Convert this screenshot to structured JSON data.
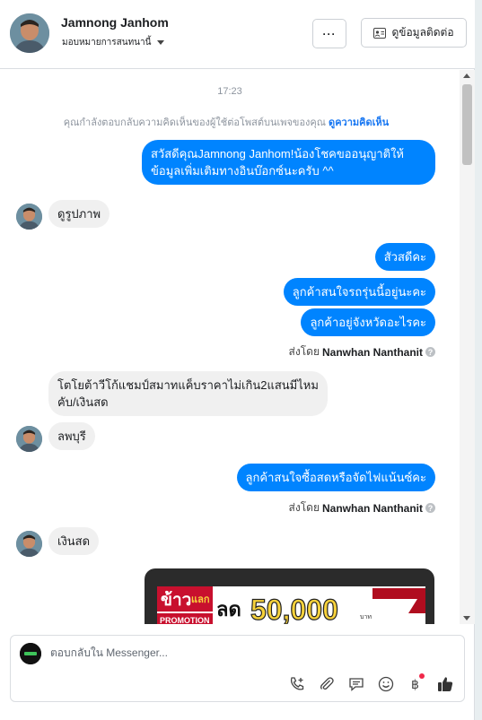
{
  "header": {
    "name": "Jamnong Janhom",
    "assign_label": "มอบหมายการสนทนานี้",
    "more_label": "···",
    "contact_label": "ดูข้อมูลติดต่อ"
  },
  "chat": {
    "time": "17:23",
    "notice_text": "คุณกำลังตอบกลับความคิดเห็นของผู้ใช้ต่อโพสต์บนเพจของคุณ",
    "notice_link": "ดูความคิดเห็น",
    "messages": [
      {
        "dir": "out",
        "lines": [
          "สวัสดีคุณJamnong Janhom!น้องโชคขออนุญาติให้",
          "ข้อมูลเพิ่มเติมทางอินบ๊อกซ์นะครับ ^^"
        ]
      },
      {
        "dir": "in",
        "text": "ดูรูปภาพ"
      },
      {
        "dir": "out",
        "text": "สัวสดีคะ"
      },
      {
        "dir": "out",
        "text": "ลูกค้าสนใจรถรุ่นนี้อยู่นะคะ"
      },
      {
        "dir": "out",
        "text": "ลูกค้าอยู่จังหวัดอะไรคะ"
      },
      {
        "dir": "in",
        "lines": [
          "โตโยต้าวีโก้แชมป์สมาทแค็บราคาไม่เกิน2แสนมีไหม",
          "คับ/เงินสด"
        ]
      },
      {
        "dir": "in",
        "text": "ลพบุรี"
      },
      {
        "dir": "out",
        "text": "ลูกค้าสนใจซื้อสดหรือจัดไฟแน้นซ์คะ"
      },
      {
        "dir": "in",
        "text": "เงินสด"
      }
    ],
    "sent_by_prefix": "ส่งโดย",
    "sent_by_name": "Nanwhan Nanthanit",
    "promo": {
      "word1": "ข้าว",
      "word2": "แลก",
      "word3": "ลด",
      "amount": "50,000",
      "unit": "บาท",
      "tag": "PROMOTION"
    }
  },
  "composer": {
    "placeholder": "ตอบกลับใน Messenger..."
  },
  "colors": {
    "accent": "#0084ff",
    "bubble_in": "#f0f0f0",
    "link": "#1877f2"
  }
}
